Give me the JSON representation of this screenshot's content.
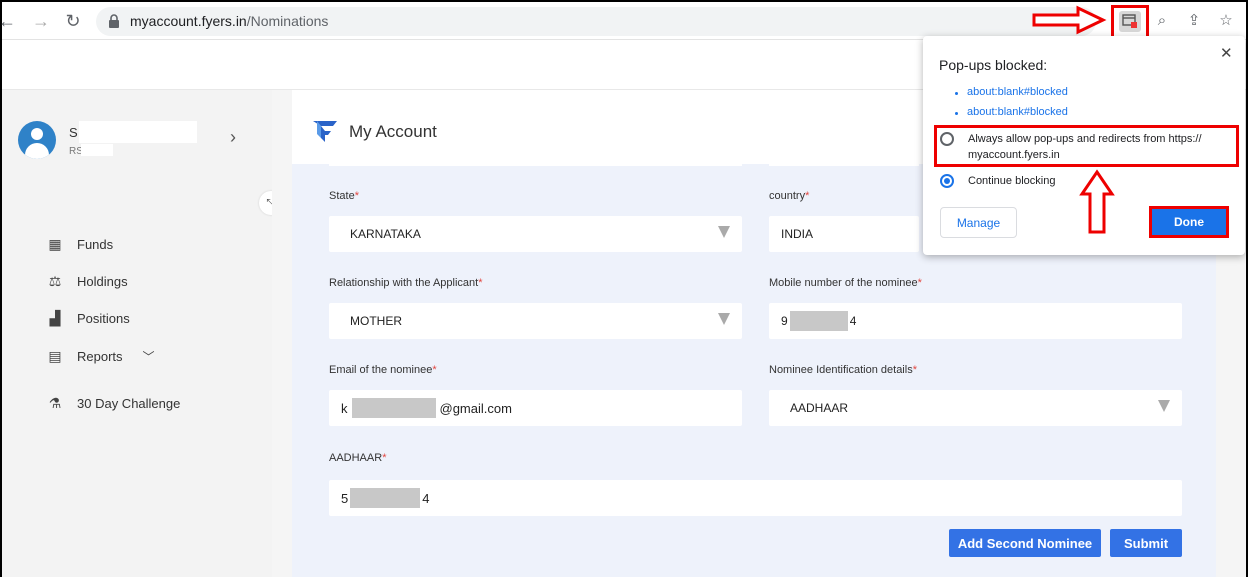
{
  "browser": {
    "url_host": "myaccount.fyers.in",
    "url_path": "/Nominations",
    "back_icon": "arrow-left-icon",
    "forward_icon": "arrow-right-icon",
    "reload_icon": "reload-icon",
    "lock_icon": "lock-icon"
  },
  "sidebar": {
    "user_initial": "S",
    "user_sub": "RS",
    "items": [
      {
        "label": "Funds",
        "icon": "funds-icon"
      },
      {
        "label": "Holdings",
        "icon": "holdings-icon"
      },
      {
        "label": "Positions",
        "icon": "positions-icon"
      },
      {
        "label": "Reports",
        "icon": "reports-icon"
      },
      {
        "label": "30 Day Challenge",
        "icon": "flask-icon"
      }
    ]
  },
  "main": {
    "title": "My Account",
    "fields": {
      "state_label": "State",
      "state_value": "KARNATAKA",
      "country_label": "country",
      "country_value": "INDIA",
      "relationship_label": "Relationship with the Applicant",
      "relationship_value": "MOTHER",
      "mobile_label": "Mobile number of the nominee",
      "mobile_prefix": "9",
      "mobile_suffix": "4",
      "email_label": "Email of the nominee",
      "email_prefix": "k",
      "email_suffix": "@gmail.com",
      "id_label": "Nominee Identification details",
      "id_value": "AADHAAR",
      "aadhaar_label": "AADHAAR",
      "aadhaar_prefix": "5",
      "aadhaar_suffix": "4",
      "required_mark": "*"
    },
    "buttons": {
      "add_second": "Add Second Nominee",
      "submit": "Submit"
    }
  },
  "popup": {
    "title": "Pop-ups blocked:",
    "close": "✕",
    "links": [
      "about:blank#blocked",
      "about:blank#blocked"
    ],
    "option_allow": "Always allow pop-ups and redirects from https://",
    "option_allow_host": "myaccount.fyers.in",
    "option_block": "Continue blocking",
    "selected": "Continue blocking",
    "manage": "Manage",
    "done": "Done"
  },
  "colors": {
    "accent": "#3372e5",
    "annotation": "#e00000",
    "avatar": "#2f82c8"
  }
}
